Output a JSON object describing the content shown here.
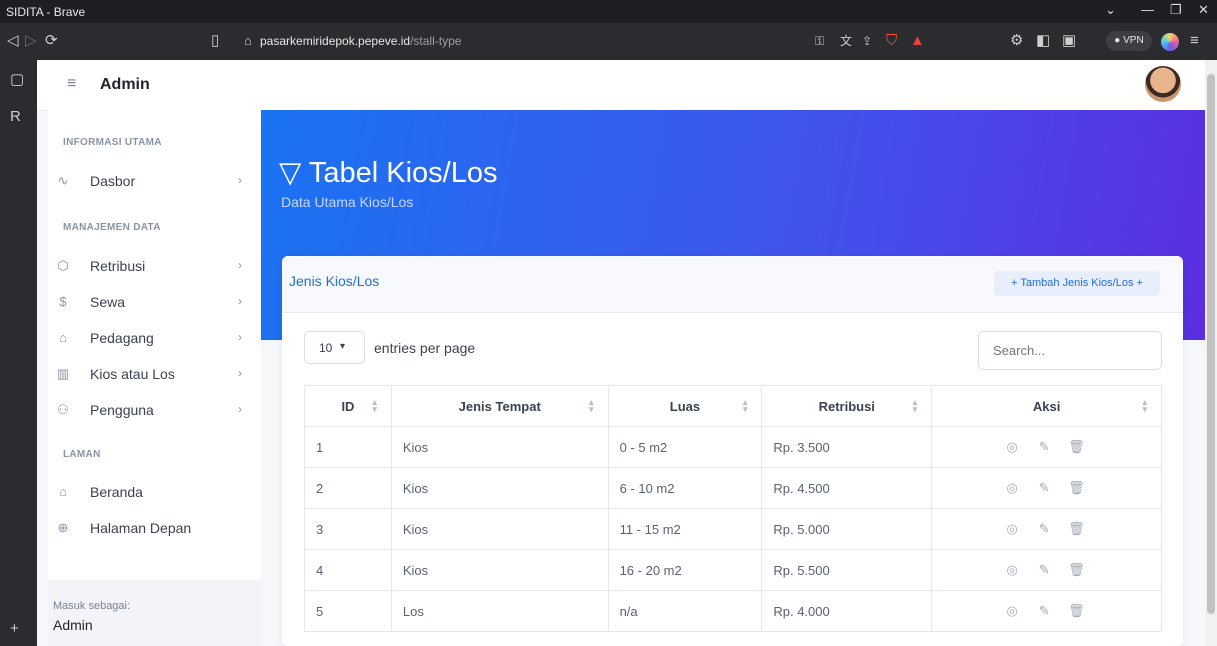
{
  "browser": {
    "window_title": "SIDITA - Brave",
    "url_host": "pasarkemiridepok.pepeve.id",
    "url_path": "/stall-type",
    "vpn_label": "VPN"
  },
  "header": {
    "title": "Admin"
  },
  "sidebar": {
    "sections": [
      {
        "title": "INFORMASI UTAMA",
        "items": [
          {
            "label": "Dasbor",
            "icon": "activity-icon"
          }
        ]
      },
      {
        "title": "MANAJEMEN DATA",
        "items": [
          {
            "label": "Retribusi",
            "icon": "box-icon"
          },
          {
            "label": "Sewa",
            "icon": "dollar-icon"
          },
          {
            "label": "Pedagang",
            "icon": "shop-icon"
          },
          {
            "label": "Kios atau Los",
            "icon": "map-icon"
          },
          {
            "label": "Pengguna",
            "icon": "users-icon"
          }
        ]
      },
      {
        "title": "LAMAN",
        "items": [
          {
            "label": "Beranda",
            "icon": "home-icon"
          },
          {
            "label": "Halaman Depan",
            "icon": "globe-icon"
          }
        ]
      }
    ],
    "footer": {
      "label": "Masuk sebagai:",
      "user": "Admin"
    }
  },
  "hero": {
    "title": "Tabel Kios/Los",
    "subtitle": "Data Utama Kios/Los"
  },
  "card": {
    "title": "Jenis Kios/Los",
    "add_button": "+ Tambah Jenis Kios/Los +",
    "per_page_value": "10",
    "per_page_label": "entries per page",
    "search_placeholder": "Search...",
    "columns": [
      "ID",
      "Jenis Tempat",
      "Luas",
      "Retribusi",
      "Aksi"
    ],
    "rows": [
      {
        "id": "1",
        "jenis": "Kios",
        "luas": "0 - 5 m2",
        "retribusi": "Rp. 3.500"
      },
      {
        "id": "2",
        "jenis": "Kios",
        "luas": "6 - 10 m2",
        "retribusi": "Rp. 4.500"
      },
      {
        "id": "3",
        "jenis": "Kios",
        "luas": "11 - 15 m2",
        "retribusi": "Rp. 5.000"
      },
      {
        "id": "4",
        "jenis": "Kios",
        "luas": "16 - 20 m2",
        "retribusi": "Rp. 5.500"
      },
      {
        "id": "5",
        "jenis": "Los",
        "luas": "n/a",
        "retribusi": "Rp. 4.000"
      }
    ]
  },
  "colors": {
    "accent": "#1e6fd9",
    "hero_start": "#1a73f2",
    "hero_end": "#5b2ee0"
  }
}
